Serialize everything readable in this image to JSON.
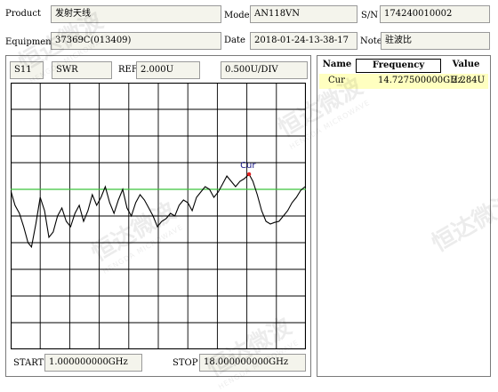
{
  "info": {
    "product_label": "Product",
    "product_value": "发射天线",
    "model_label": "Model",
    "model_value": "AN118VN",
    "sn_label": "S/N",
    "sn_value": "174240010002",
    "equipment_label": "Equipment",
    "equipment_value": "37369C(013409)",
    "date_label": "Date",
    "date_value": "2018-01-24-13-38-17",
    "note_label": "Note",
    "note_value": "驻波比"
  },
  "trace_settings": {
    "param": "S11",
    "format": "SWR",
    "ref_label": "REF",
    "ref_value": "2.000U",
    "scale": "0.500U/DIV"
  },
  "sweep": {
    "start_label": "START",
    "start_value": "1.000000000GHz",
    "stop_label": "STOP",
    "stop_value": "18.000000000GHz"
  },
  "marker_table": {
    "headers": {
      "name": "Name",
      "frequency": "Frequency",
      "value": "Value"
    },
    "rows": [
      {
        "name": "Cur",
        "frequency": "14.727500000GHz",
        "value": "2.284U"
      }
    ]
  },
  "marker_label": "Cur",
  "watermark": {
    "text": "恒达微波",
    "sub": "HENGDA MICROWAVE"
  },
  "colors": {
    "trace": "#000000",
    "reference_line": "#3cc33c",
    "marker": "#e02020",
    "marker_label": "#1a1a8a",
    "selected_row": "#ffffc0",
    "field_bg": "#f4f4ec"
  },
  "chart_data": {
    "type": "line",
    "x_range_ghz": [
      1.0,
      18.0
    ],
    "y_range": [
      -1.0,
      4.0
    ],
    "reference_level": 2.0,
    "grid_divisions": {
      "x": 10,
      "y": 10
    },
    "grid": true,
    "x": [
      1.0,
      1.25,
      1.5,
      1.75,
      2.0,
      2.2,
      2.45,
      2.7,
      2.95,
      3.2,
      3.45,
      3.7,
      3.95,
      4.2,
      4.45,
      4.7,
      4.95,
      5.2,
      5.45,
      5.7,
      5.95,
      6.2,
      6.45,
      6.7,
      6.95,
      7.2,
      7.45,
      7.7,
      7.95,
      8.2,
      8.45,
      8.7,
      8.95,
      9.2,
      9.45,
      9.7,
      9.95,
      10.2,
      10.45,
      10.7,
      10.95,
      11.2,
      11.45,
      11.7,
      11.95,
      12.2,
      12.45,
      12.7,
      12.95,
      13.2,
      13.45,
      13.7,
      13.95,
      14.2,
      14.45,
      14.73,
      14.95,
      15.2,
      15.45,
      15.7,
      15.95,
      16.2,
      16.45,
      16.7,
      16.95,
      17.2,
      17.45,
      17.7,
      17.95
    ],
    "y": [
      1.98,
      1.7,
      1.55,
      1.3,
      1.0,
      0.92,
      1.35,
      1.85,
      1.6,
      1.1,
      1.2,
      1.5,
      1.65,
      1.4,
      1.3,
      1.55,
      1.7,
      1.4,
      1.6,
      1.9,
      1.7,
      1.85,
      2.05,
      1.75,
      1.55,
      1.8,
      2.0,
      1.65,
      1.5,
      1.75,
      1.9,
      1.8,
      1.65,
      1.5,
      1.3,
      1.4,
      1.45,
      1.55,
      1.5,
      1.7,
      1.8,
      1.75,
      1.6,
      1.85,
      1.95,
      2.05,
      2.0,
      1.85,
      1.95,
      2.1,
      2.25,
      2.15,
      2.05,
      2.15,
      2.2,
      2.284,
      2.15,
      1.9,
      1.6,
      1.4,
      1.35,
      1.38,
      1.4,
      1.5,
      1.6,
      1.75,
      1.85,
      1.98,
      2.05
    ],
    "marker": {
      "name": "Cur",
      "x": 14.7275,
      "y": 2.284
    }
  }
}
